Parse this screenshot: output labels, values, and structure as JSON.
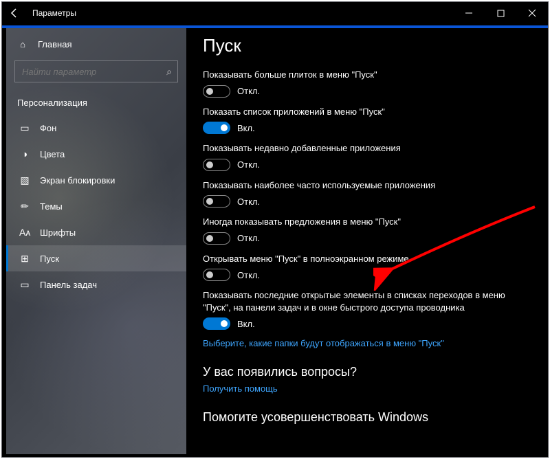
{
  "window": {
    "title": "Параметры"
  },
  "sidebar": {
    "home": "Главная",
    "search_placeholder": "Найти параметр",
    "category": "Персонализация",
    "items": [
      {
        "icon": "▭",
        "label": "Фон"
      },
      {
        "icon": "◑",
        "label": "Цвета"
      },
      {
        "icon": "▧",
        "label": "Экран блокировки"
      },
      {
        "icon": "✏",
        "label": "Темы"
      },
      {
        "icon": "Aᴀ",
        "label": "Шрифты"
      },
      {
        "icon": "⊞",
        "label": "Пуск"
      },
      {
        "icon": "▭",
        "label": "Панель задач"
      }
    ],
    "active_index": 5
  },
  "main": {
    "heading": "Пуск",
    "settings": [
      {
        "label": "Показывать больше плиток в меню \"Пуск\"",
        "on": false,
        "state": "Откл."
      },
      {
        "label": "Показать список приложений в меню \"Пуск\"",
        "on": true,
        "state": "Вкл."
      },
      {
        "label": "Показывать недавно добавленные приложения",
        "on": false,
        "state": "Откл."
      },
      {
        "label": "Показывать наиболее часто используемые приложения",
        "on": false,
        "state": "Откл."
      },
      {
        "label": "Иногда показывать предложения в меню \"Пуск\"",
        "on": false,
        "state": "Откл."
      },
      {
        "label": "Открывать меню \"Пуск\" в полноэкранном режиме",
        "on": false,
        "state": "Откл."
      },
      {
        "label": "Показывать последние открытые элементы в списках переходов в меню \"Пуск\", на панели задач и в окне быстрого доступа проводника",
        "on": true,
        "state": "Вкл."
      }
    ],
    "folders_link": "Выберите, какие папки будут отображаться в меню \"Пуск\"",
    "faq_heading": "У вас появились вопросы?",
    "help_link": "Получить помощь",
    "improve_heading": "Помогите усовершенствовать Windows"
  },
  "annotation": {
    "color": "#ff0000"
  }
}
